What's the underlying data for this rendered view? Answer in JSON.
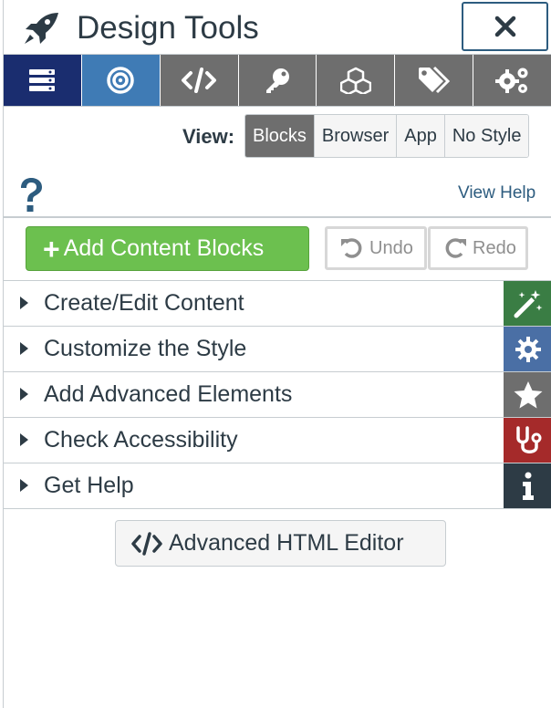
{
  "header": {
    "title": "Design Tools",
    "close_symbol": "✕"
  },
  "toolbar": {
    "tools": [
      {
        "name": "blocks-tool",
        "icon": "server-icon",
        "active": false
      },
      {
        "name": "target-tool",
        "icon": "bullseye-icon",
        "active": true
      },
      {
        "name": "code-tool",
        "icon": "code-icon",
        "active": false
      },
      {
        "name": "key-tool",
        "icon": "key-icon",
        "active": false
      },
      {
        "name": "cubes-tool",
        "icon": "cubes-icon",
        "active": false
      },
      {
        "name": "tags-tool",
        "icon": "tags-icon",
        "active": false
      },
      {
        "name": "settings-tool",
        "icon": "gears-icon",
        "active": false
      }
    ]
  },
  "view": {
    "label": "View:",
    "options": [
      "Blocks",
      "Browser",
      "App",
      "No Style"
    ],
    "selected": "Blocks"
  },
  "help": {
    "link_text": "View Help"
  },
  "actions": {
    "add_blocks_label": "Add Content Blocks",
    "undo_label": "Undo",
    "redo_label": "Redo"
  },
  "sections": [
    {
      "label": "Create/Edit Content",
      "icon": "magic-wand-icon",
      "color": "#3a7d44"
    },
    {
      "label": "Customize the Style",
      "icon": "gear-icon",
      "color": "#4a6fa5"
    },
    {
      "label": "Add Advanced Elements",
      "icon": "star-icon",
      "color": "#6e6e6e"
    },
    {
      "label": "Check Accessibility",
      "icon": "stethoscope-icon",
      "color": "#a52a2a"
    },
    {
      "label": "Get Help",
      "icon": "info-icon",
      "color": "#2d3b45"
    }
  ],
  "editor": {
    "label": "Advanced HTML Editor"
  },
  "colors": {
    "primary_dark": "#1a2d6f",
    "active_tab": "#3f7bb5",
    "add_green": "#6cc04f",
    "link_blue": "#2d5c7f"
  }
}
